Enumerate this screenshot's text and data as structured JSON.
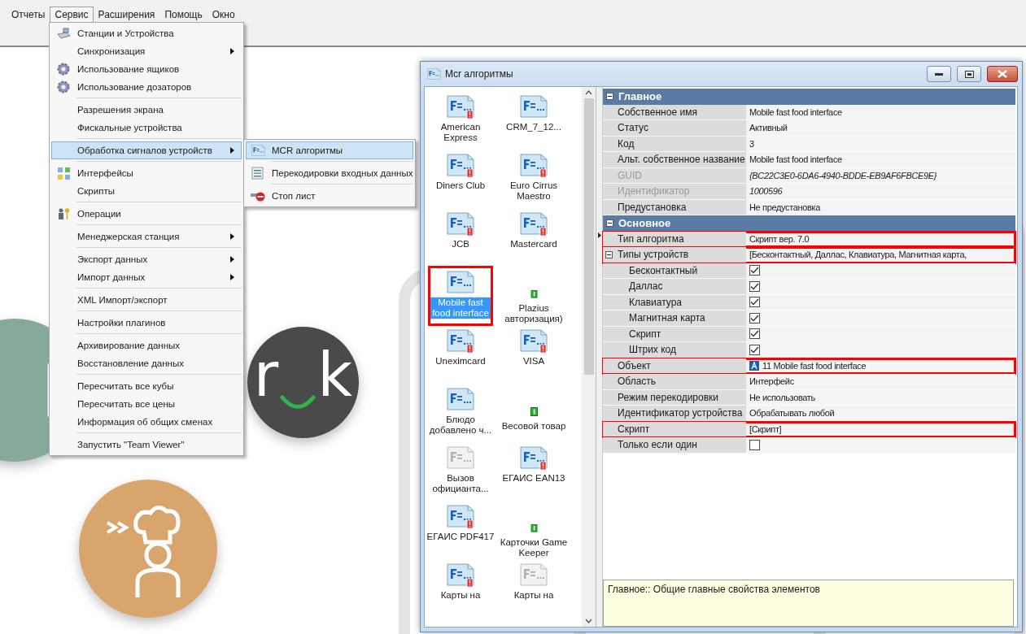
{
  "menubar": [
    {
      "label": "Отчеты",
      "selected": false
    },
    {
      "label": "Сервис",
      "selected": true
    },
    {
      "label": "Расширения",
      "selected": false
    },
    {
      "label": "Помощь",
      "selected": false
    },
    {
      "label": "Окно",
      "selected": false
    }
  ],
  "menu": {
    "groups": [
      {
        "items": [
          {
            "label": "Станции и Устройства",
            "submenu": false,
            "selected": false
          },
          {
            "label": "Синхронизация",
            "submenu": true,
            "selected": false
          },
          {
            "label": "Использование ящиков",
            "submenu": false,
            "selected": false
          },
          {
            "label": "Использование дозаторов",
            "submenu": false,
            "selected": false
          }
        ]
      },
      {
        "items": [
          {
            "label": "Разрешения экрана",
            "submenu": false,
            "selected": false
          },
          {
            "label": "Фискальные устройства",
            "submenu": false,
            "selected": false
          }
        ]
      },
      {
        "items": [
          {
            "label": "Обработка сигналов устройств",
            "submenu": true,
            "selected": true
          }
        ]
      },
      {
        "items": [
          {
            "label": "Интерфейсы",
            "submenu": false,
            "selected": false
          },
          {
            "label": "Скрипты",
            "submenu": false,
            "selected": false
          }
        ]
      },
      {
        "items": [
          {
            "label": "Операции",
            "submenu": false,
            "selected": false
          }
        ]
      },
      {
        "items": [
          {
            "label": "Менеджерская станция",
            "submenu": true,
            "selected": false
          }
        ]
      },
      {
        "items": [
          {
            "label": "Экспорт данных",
            "submenu": true,
            "selected": false
          },
          {
            "label": "Импорт данных",
            "submenu": true,
            "selected": false
          }
        ]
      },
      {
        "items": [
          {
            "label": "XML Импорт/экспорт",
            "submenu": false,
            "selected": false
          }
        ]
      },
      {
        "items": [
          {
            "label": "Настройки плагинов",
            "submenu": false,
            "selected": false
          }
        ]
      },
      {
        "items": [
          {
            "label": "Архивирование данных",
            "submenu": false,
            "selected": false
          },
          {
            "label": "Восстановление данных",
            "submenu": false,
            "selected": false
          }
        ]
      },
      {
        "items": [
          {
            "label": "Пересчитать все кубы",
            "submenu": false,
            "selected": false
          },
          {
            "label": "Пересчитать все цены",
            "submenu": false,
            "selected": false
          },
          {
            "label": "Информация об общих сменах",
            "submenu": false,
            "selected": false
          }
        ]
      },
      {
        "items": [
          {
            "label": "Запустить \"Team Viewer\"",
            "submenu": false,
            "selected": false
          }
        ]
      }
    ]
  },
  "submenu": {
    "items": [
      {
        "label": "MCR алгоритмы",
        "selected": true
      },
      {
        "label": "Перекодировки входных данных",
        "selected": false
      },
      {
        "label": "Стоп лист",
        "selected": false
      }
    ]
  },
  "logo": {
    "left": "r",
    "right": "k"
  },
  "window": {
    "title": "Mcr алгоритмы",
    "list": {
      "items": [
        {
          "label": "American Express",
          "kind": "formula-alert",
          "selected": false,
          "annotated": false
        },
        {
          "label": "CRM_7_12...",
          "kind": "formula",
          "selected": false,
          "annotated": false
        },
        {
          "label": "Diners Club",
          "kind": "formula-alert",
          "selected": false,
          "annotated": false
        },
        {
          "label": "Euro Cirrus Maestro",
          "kind": "formula-alert",
          "selected": false,
          "annotated": false
        },
        {
          "label": "JCB",
          "kind": "formula-alert",
          "selected": false,
          "annotated": false
        },
        {
          "label": "Mastercard",
          "kind": "formula-alert",
          "selected": false,
          "annotated": false
        },
        {
          "label": "Mobile fast food interface",
          "kind": "formula",
          "selected": true,
          "annotated": true
        },
        {
          "label": "Plazius авторизация)",
          "kind": "counter",
          "selected": false,
          "annotated": false
        },
        {
          "label": "Uneximcard",
          "kind": "formula-alert",
          "selected": false,
          "annotated": false
        },
        {
          "label": "VISA",
          "kind": "formula-alert",
          "selected": false,
          "annotated": false
        },
        {
          "label": "Блюдо добавлено ч...",
          "kind": "formula",
          "selected": false,
          "annotated": false
        },
        {
          "label": "Весовой товар",
          "kind": "counter",
          "selected": false,
          "annotated": false
        },
        {
          "label": "Вызов официанта...",
          "kind": "formula-grey",
          "selected": false,
          "annotated": false
        },
        {
          "label": "ЕГАИС EAN13",
          "kind": "formula-alert",
          "selected": false,
          "annotated": false
        },
        {
          "label": "ЕГАИС PDF417",
          "kind": "formula-alert",
          "selected": false,
          "annotated": false
        },
        {
          "label": "Карточки Game Keeper",
          "kind": "counter",
          "selected": false,
          "annotated": false
        },
        {
          "label": "Карты на",
          "kind": "formula-alert",
          "selected": false,
          "annotated": false
        },
        {
          "label": "Карты на",
          "kind": "formula-grey",
          "selected": false,
          "annotated": false
        }
      ]
    },
    "properties": {
      "categories": [
        {
          "title": "Главное",
          "expanded": true,
          "rows": [
            {
              "label": "Собственное имя",
              "value": "Mobile fast food interface",
              "kind": "text",
              "disabled": false,
              "annotated": false
            },
            {
              "label": "Статус",
              "value": "Активный",
              "kind": "text",
              "disabled": false,
              "annotated": false
            },
            {
              "label": "Код",
              "value": "3",
              "kind": "text",
              "disabled": false,
              "annotated": false
            },
            {
              "label": "Альт. собственное название",
              "value": "Mobile fast food interface",
              "kind": "text",
              "disabled": false,
              "annotated": false
            },
            {
              "label": "GUID",
              "value": "{BC22C3E0-6DA6-4940-BDDE-EB9AF6FBCE9E}",
              "kind": "text",
              "disabled": true,
              "annotated": false
            },
            {
              "label": "Идентификатор",
              "value": "1000596",
              "kind": "text",
              "disabled": true,
              "annotated": false
            },
            {
              "label": "Предустановка",
              "value": "Не предустановка",
              "kind": "text",
              "disabled": false,
              "annotated": false
            }
          ]
        },
        {
          "title": "Основное",
          "expanded": true,
          "rows": [
            {
              "label": "Тип алгоритма",
              "value": "Скрипт вер. 7.0",
              "kind": "text",
              "disabled": false,
              "annotated": true
            },
            {
              "label": "Типы устройств",
              "value": "[Бесконтактный, Даллас, Клавиатура, Магнитная карта,",
              "kind": "text",
              "disabled": false,
              "annotated": true,
              "expanded": true,
              "children": [
                {
                  "label": "Бесконтактный",
                  "kind": "checkbox",
                  "checked": true,
                  "disabled": false,
                  "annotated": false
                },
                {
                  "label": "Даллас",
                  "kind": "checkbox",
                  "checked": true,
                  "disabled": false,
                  "annotated": false
                },
                {
                  "label": "Клавиатура",
                  "kind": "checkbox",
                  "checked": true,
                  "disabled": false,
                  "annotated": false
                },
                {
                  "label": "Магнитная карта",
                  "kind": "checkbox",
                  "checked": true,
                  "disabled": false,
                  "annotated": false
                },
                {
                  "label": "Скрипт",
                  "kind": "checkbox",
                  "checked": true,
                  "disabled": false,
                  "annotated": false
                },
                {
                  "label": "Штрих код",
                  "kind": "checkbox",
                  "checked": true,
                  "disabled": false,
                  "annotated": false
                }
              ]
            },
            {
              "label": "Объект",
              "value": "11 Mobile fast food interface",
              "kind": "object",
              "disabled": false,
              "annotated": true
            },
            {
              "label": "Область",
              "value": "Интерфейс",
              "kind": "text",
              "disabled": false,
              "annotated": false
            },
            {
              "label": "Режим перекодировки",
              "value": "Не использовать",
              "kind": "text",
              "disabled": false,
              "annotated": false
            },
            {
              "label": "Идентификатор устройства",
              "value": "Обрабатывать любой",
              "kind": "text",
              "disabled": false,
              "annotated": false
            },
            {
              "label": "Скрипт",
              "value": "[Скрипт]",
              "kind": "text",
              "disabled": false,
              "annotated": true
            },
            {
              "label": "Только если один",
              "kind": "checkbox",
              "checked": false,
              "disabled": false,
              "annotated": false
            }
          ]
        }
      ]
    },
    "description": "Главное:: Общие главные свойства элементов"
  }
}
